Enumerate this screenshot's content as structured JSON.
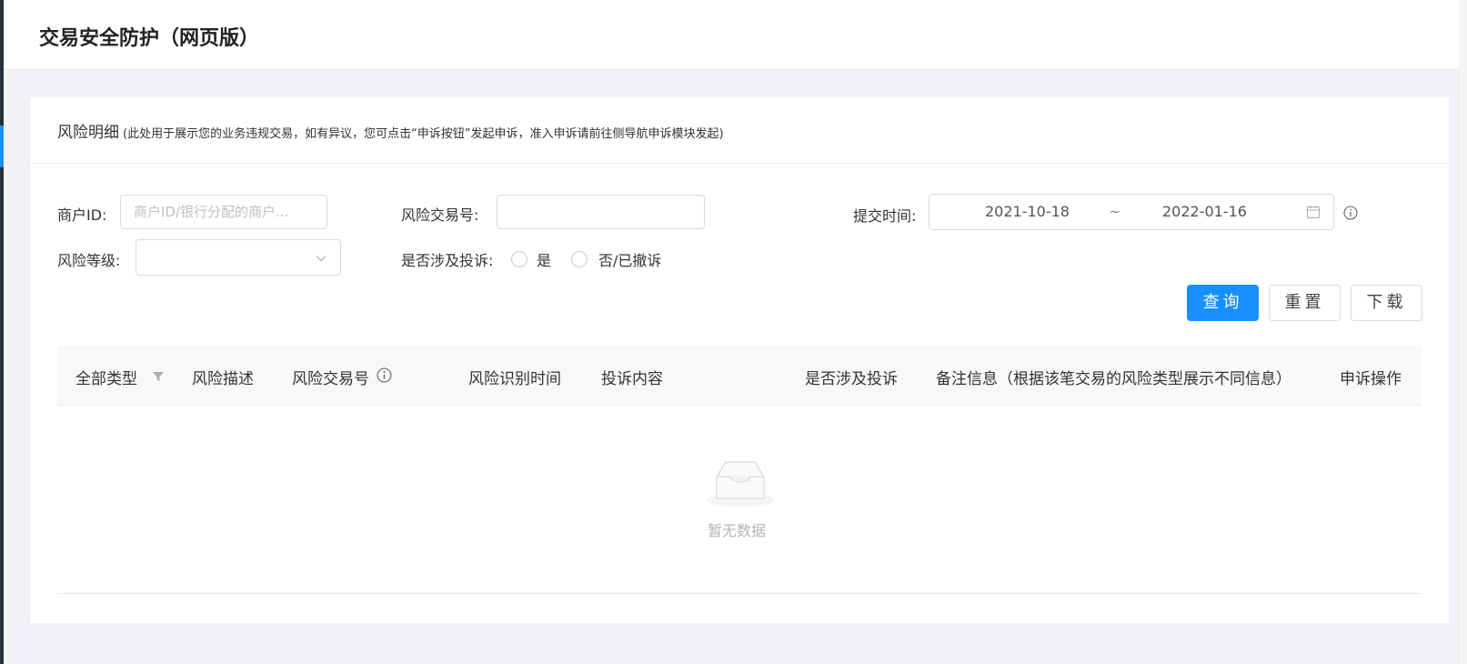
{
  "page": {
    "title": "交易安全防护（网页版）"
  },
  "card": {
    "title": "风险明细",
    "note": "(此处用于展示您的业务违规交易，如有异议，您可点击“申诉按钮”发起申诉，准入申诉请前往侧导航申诉模块发起)"
  },
  "filters": {
    "merchant_id_label": "商户ID:",
    "merchant_id_placeholder": "商户ID/银行分配的商户...",
    "merchant_id_value": "",
    "risk_txn_label": "风险交易号:",
    "risk_txn_value": "",
    "submit_time_label": "提交时间:",
    "date_start": "2021-10-18",
    "date_separator": "~",
    "date_end": "2022-01-16",
    "risk_level_label": "风险等级:",
    "risk_level_value": "",
    "complaint_label": "是否涉及投诉:",
    "complaint_options": [
      "是",
      "否/已撤诉"
    ]
  },
  "buttons": {
    "query": "查询",
    "reset": "重置",
    "download": "下载"
  },
  "table": {
    "columns": [
      "全部类型",
      "风险描述",
      "风险交易号",
      "风险识别时间",
      "投诉内容",
      "是否涉及投诉",
      "备注信息（根据该笔交易的风险类型展示不同信息）",
      "申诉操作"
    ],
    "rows": [],
    "empty_text": "暂无数据"
  },
  "icons": {
    "calendar": "calendar-icon",
    "info": "info-circle-icon",
    "dropdown": "chevron-down-icon",
    "filter": "filter-icon",
    "empty": "empty-inbox-icon"
  },
  "colors": {
    "primary": "#1890ff",
    "background": "#f0f2f5",
    "border": "#d9d9d9"
  }
}
